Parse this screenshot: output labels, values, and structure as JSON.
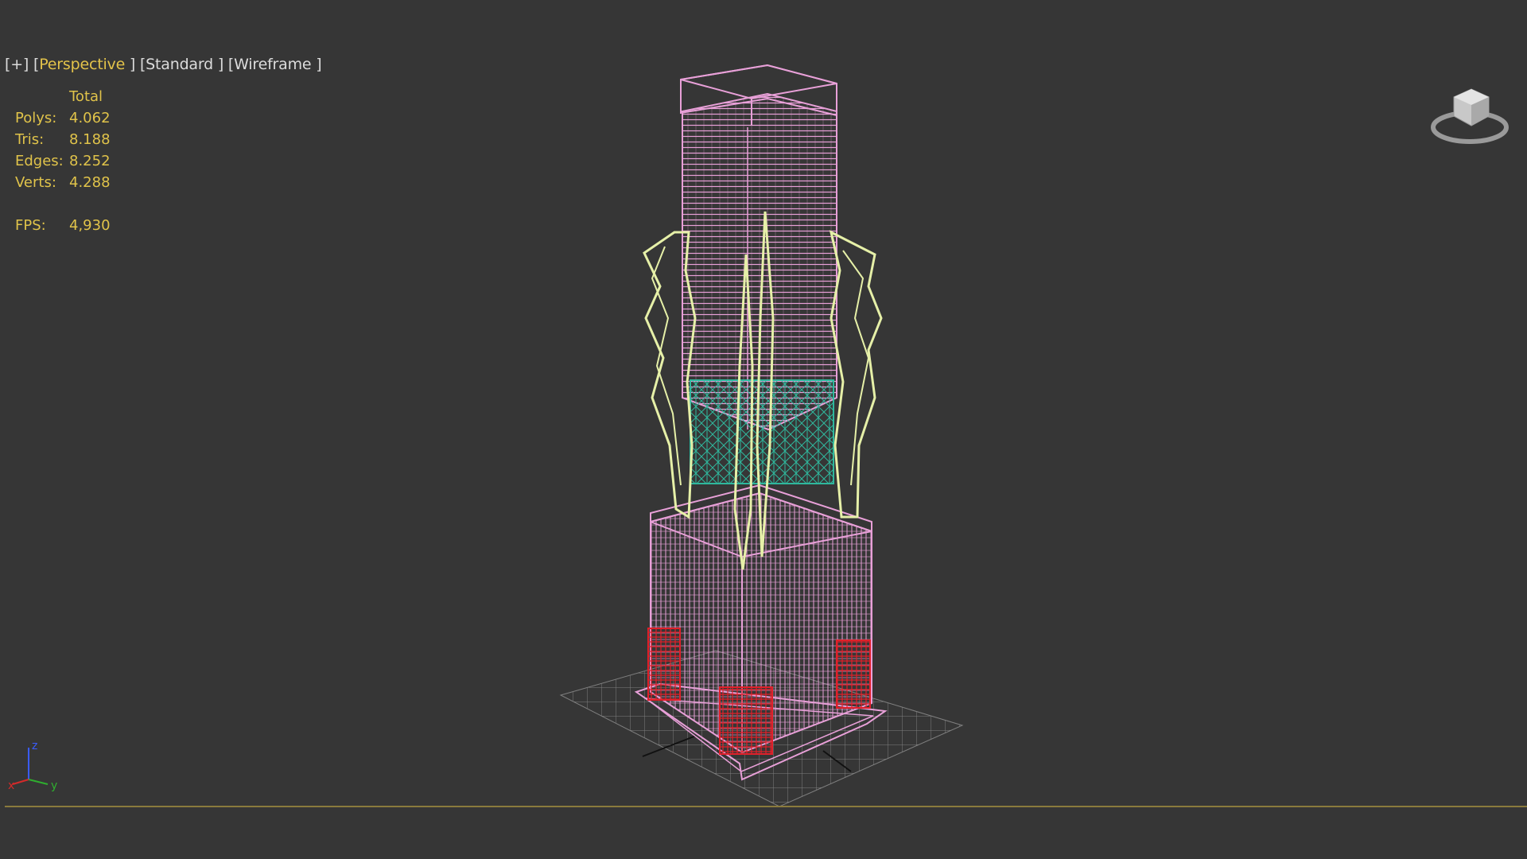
{
  "viewport": {
    "labels": {
      "plus": "[+]",
      "view_open": "[",
      "view": "Perspective",
      "view_close": "]",
      "shading": "[Standard ]",
      "display": "[Wireframe ]"
    },
    "stats": {
      "header": "Total",
      "rows": [
        {
          "label": "Polys:",
          "value": "4.062"
        },
        {
          "label": "Tris:",
          "value": "8.188"
        },
        {
          "label": "Edges:",
          "value": "8.252"
        },
        {
          "label": "Verts:",
          "value": "4.288"
        }
      ],
      "fps_label": "FPS:",
      "fps_value": "4,930"
    },
    "axis": {
      "z": "z",
      "x": "x",
      "y": "y"
    },
    "icons": [
      "viewcube-icon",
      "axis-tripod-icon"
    ],
    "colors": {
      "background": "#363636",
      "label_text": "#dcdcdc",
      "active_label": "#e3c34a",
      "stats_text": "#e0c34a",
      "wire_pink": "#e8a0d8",
      "wire_yellow": "#e6f0a8",
      "wire_teal": "#2fbfa3",
      "wire_red": "#e0202a",
      "grid": "#8c8c8c",
      "timeline": "#8a7a3c"
    }
  }
}
